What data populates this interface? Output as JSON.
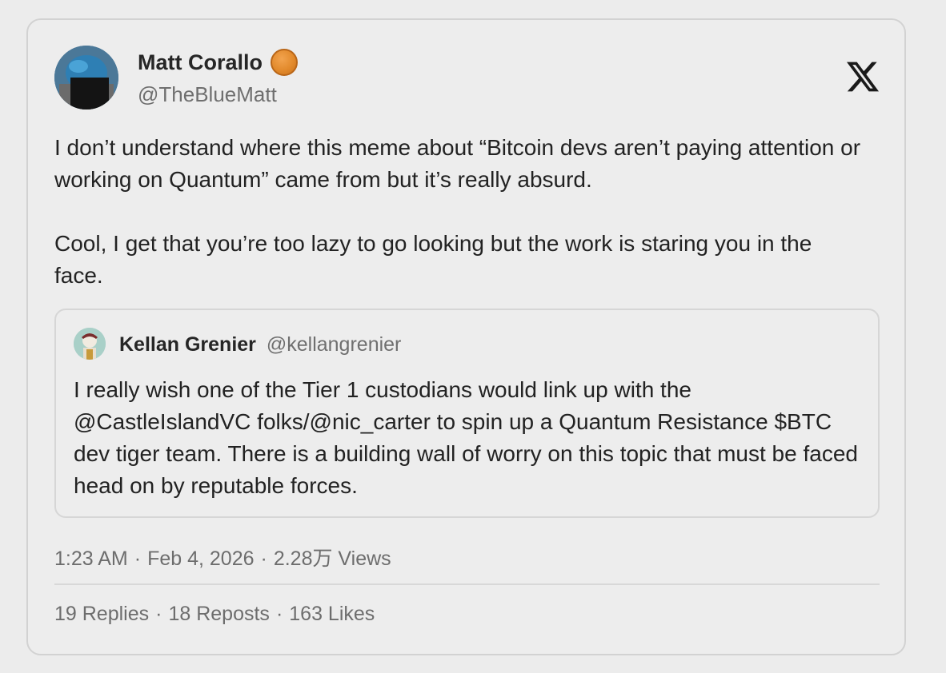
{
  "post": {
    "author": {
      "name": "Matt Corallo",
      "handle": "@TheBlueMatt",
      "badge_color": "#e28a2c"
    },
    "platform_icon": "x-logo-icon",
    "text": "I don’t understand where this meme about “Bitcoin devs aren’t paying attention or working on Quantum” came from but it’s really absurd.\n\nCool, I get that you’re too lazy to go looking but the work is staring you in the face.",
    "quoted": {
      "name": "Kellan Grenier",
      "handle": "@kellangrenier",
      "text": "I really wish one of the Tier 1 custodians would link up with the @CastleIslandVC folks/@nic_carter to spin up a Quantum Resistance $BTC dev tiger team. There is a building wall of worry on this topic that must be faced head on by reputable forces."
    },
    "meta": {
      "time": "1:23 AM",
      "date": "Feb 4, 2026",
      "views": "2.28万 Views"
    },
    "stats": {
      "replies": "19 Replies",
      "reposts": "18 Reposts",
      "likes": "163 Likes"
    },
    "separator": "·"
  }
}
